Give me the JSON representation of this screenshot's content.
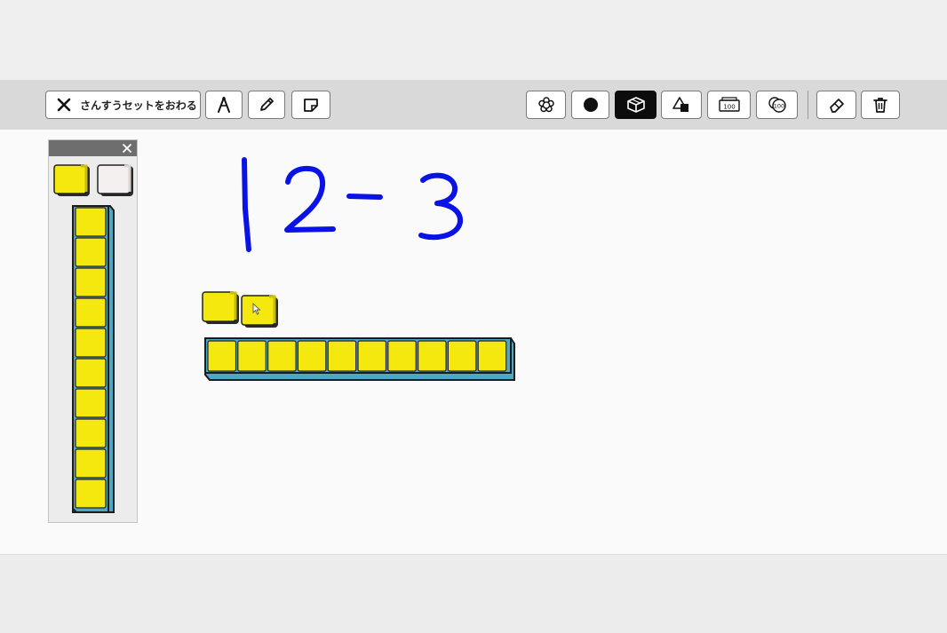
{
  "toolbar": {
    "end_label": "さんすうセットをおわる",
    "tools": [
      {
        "name": "compass-tool",
        "icon": "compass-icon"
      },
      {
        "name": "pen-tool",
        "icon": "pencil-icon"
      },
      {
        "name": "sticky-note-tool",
        "icon": "sticky-note-icon"
      },
      {
        "name": "flower-counter-tool",
        "icon": "flower-icon"
      },
      {
        "name": "circle-counter-tool",
        "icon": "filled-circle-icon"
      },
      {
        "name": "blocks-tool",
        "icon": "cube-icon",
        "active": true
      },
      {
        "name": "shapes-tool",
        "icon": "shapes-icon"
      },
      {
        "name": "banknote-tool",
        "icon": "banknote-100-icon",
        "label": "100"
      },
      {
        "name": "coins-tool",
        "icon": "coins-100-icon",
        "label": "100"
      },
      {
        "name": "eraser-tool",
        "icon": "eraser-icon"
      },
      {
        "name": "trash-tool",
        "icon": "trash-icon"
      }
    ]
  },
  "colors": {
    "ink": "#0a12e6",
    "block_yellow": "#f5e80e",
    "block_rod_base": "#4fa7c6",
    "active_tool": "#0c0c0c"
  },
  "palette": {
    "items": [
      "unit-block-yellow",
      "unit-block-white",
      "ten-rod"
    ],
    "rod_count": 10
  },
  "workspace": {
    "handwriting": "12 − 3",
    "loose_unit_blocks": 2,
    "ten_rod_blocks": 10
  }
}
